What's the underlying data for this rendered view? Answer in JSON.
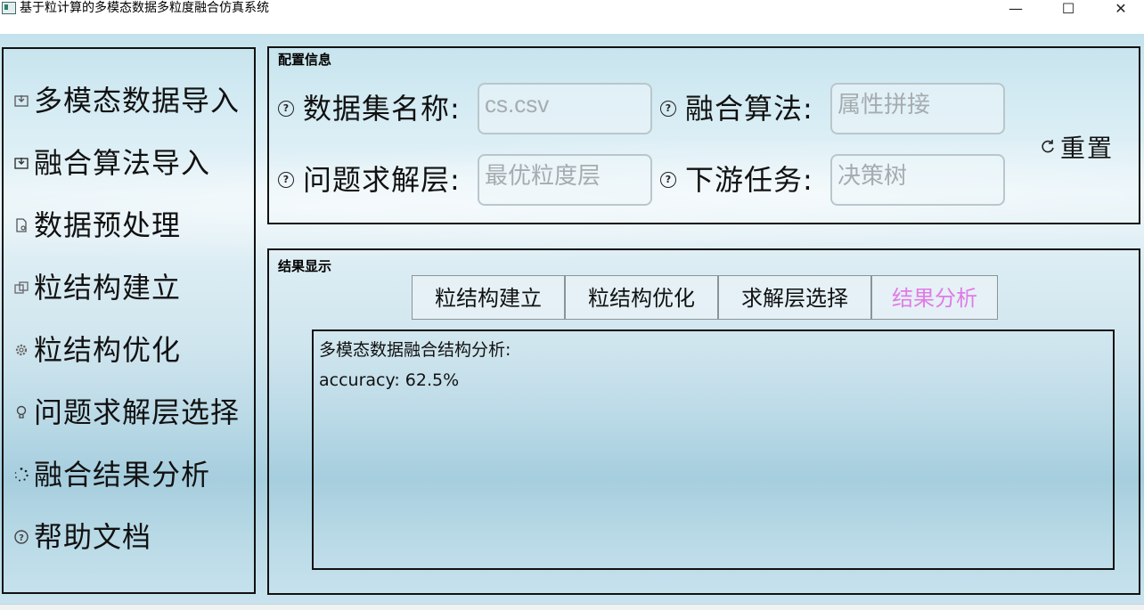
{
  "window": {
    "title": "基于粒计算的多模态数据多粒度融合仿真系统",
    "controls": {
      "minimize": "—",
      "maximize": "☐",
      "close": "✕"
    }
  },
  "sidebar": {
    "items": [
      {
        "label": "多模态数据导入",
        "icon": "import-data-icon"
      },
      {
        "label": "融合算法导入",
        "icon": "import-algorithm-icon"
      },
      {
        "label": "数据预处理",
        "icon": "file-settings-icon"
      },
      {
        "label": "粒结构建立",
        "icon": "structure-icon"
      },
      {
        "label": "粒结构优化",
        "icon": "gear-icon"
      },
      {
        "label": "问题求解层选择",
        "icon": "bulb-icon"
      },
      {
        "label": "融合结果分析",
        "icon": "loading-icon"
      },
      {
        "label": "帮助文档",
        "icon": "help-icon"
      }
    ]
  },
  "config": {
    "title": "配置信息",
    "dataset_label": "数据集名称:",
    "dataset_value": "cs.csv",
    "algorithm_label": "融合算法:",
    "algorithm_value": "属性拼接",
    "layer_label": "问题求解层:",
    "layer_value": "最优粒度层",
    "task_label": "下游任务:",
    "task_value": "决策树",
    "reset_label": "重置"
  },
  "results": {
    "title": "结果显示",
    "tabs": [
      {
        "label": "粒结构建立",
        "active": false
      },
      {
        "label": "粒结构优化",
        "active": false
      },
      {
        "label": "求解层选择",
        "active": false
      },
      {
        "label": "结果分析",
        "active": true
      }
    ],
    "heading": "多模态数据融合结构分析:",
    "accuracy": "accuracy: 62.5%"
  },
  "colors": {
    "active_tab": "#e07be6",
    "border": "#111111",
    "input_text": "#a5acaf"
  }
}
